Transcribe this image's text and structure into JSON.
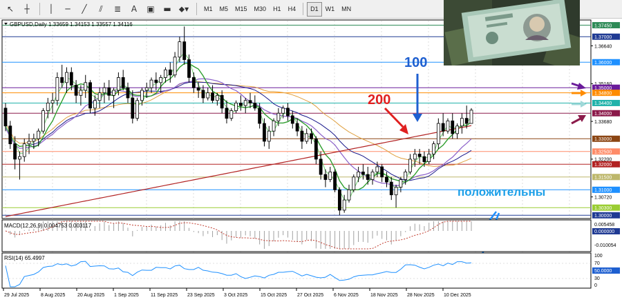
{
  "toolbar": {
    "timeframes": [
      "M1",
      "M5",
      "M15",
      "M30",
      "H1",
      "H4",
      "D1",
      "W1",
      "MN"
    ],
    "active_timeframe": "D1"
  },
  "chart": {
    "symbol_info": "GBPUSD,Daily  1.33659 1.34153 1.33557 1.34116",
    "price_levels": [
      {
        "label": "1.37450",
        "color": "#2e8b57",
        "style": "box"
      },
      {
        "label": "1.37000",
        "color": "#1f3a93",
        "style": "box"
      },
      {
        "label": "1.36640",
        "color": "#000000",
        "style": "tick"
      },
      {
        "label": "1.36000",
        "color": "#1e90ff",
        "style": "box"
      },
      {
        "label": "1.35160",
        "color": "#000000",
        "style": "tick"
      },
      {
        "label": "1.35000",
        "color": "#6a1b9a",
        "style": "box"
      },
      {
        "label": "1.34800",
        "color": "#ff8c00",
        "style": "box"
      },
      {
        "label": "1.34400",
        "color": "#20b2aa",
        "style": "box"
      },
      {
        "label": "1.34000",
        "color": "#8b1a4a",
        "style": "box"
      },
      {
        "label": "1.33680",
        "color": "#000000",
        "style": "tick"
      },
      {
        "label": "1.33000",
        "color": "#8b4513",
        "style": "box"
      },
      {
        "label": "1.32500",
        "color": "#ff8c69",
        "style": "box"
      },
      {
        "label": "1.32200",
        "color": "#000000",
        "style": "tick"
      },
      {
        "label": "1.32000",
        "color": "#b22222",
        "style": "box"
      },
      {
        "label": "1.31500",
        "color": "#bdb76b",
        "style": "box"
      },
      {
        "label": "1.31000",
        "color": "#1e90ff",
        "style": "box"
      },
      {
        "label": "1.30720",
        "color": "#000000",
        "style": "tick"
      },
      {
        "label": "1.30300",
        "color": "#9acd32",
        "style": "box"
      },
      {
        "label": "1.30000",
        "color": "#1f3a93",
        "style": "box"
      }
    ],
    "annotations": {
      "ma100": "100",
      "ma200": "200",
      "positive": "положительны"
    },
    "colors": {
      "ma100": "#1a1a8c",
      "ma200": "#b22222",
      "ma_green": "#2e9e2e",
      "ma_green_light": "#6fcf6f",
      "ma_purple": "#8a5fc9",
      "ma_orange": "#e0a040",
      "annotation_red": "#e02020",
      "annotation_blue": "#1e5fd0",
      "annotation_cyan": "#1ea0e8"
    }
  },
  "macd": {
    "label": "MACD(12,26,9) 0.004753 0.003117",
    "scale": [
      "0.005458",
      "0.000000",
      "-0.010054"
    ]
  },
  "rsi": {
    "label": "RSI(14) 65.4997",
    "scale": [
      "100",
      "70",
      "50.0000",
      "30",
      "0"
    ]
  },
  "time_axis": [
    "29 Jul 2025",
    "8 Aug 2025",
    "20 Aug 2025",
    "1 Sep 2025",
    "11 Sep 2025",
    "23 Sep 2025",
    "3 Oct 2025",
    "15 Oct 2025",
    "27 Oct 2025",
    "6 Nov 2025",
    "18 Nov 2025",
    "28 Nov 2025",
    "10 Dec 2025"
  ],
  "candles": [
    [
      1.342,
      1.344,
      1.333,
      1.335
    ],
    [
      1.335,
      1.337,
      1.326,
      1.328
    ],
    [
      1.328,
      1.331,
      1.318,
      1.322
    ],
    [
      1.322,
      1.325,
      1.314,
      1.323
    ],
    [
      1.323,
      1.33,
      1.321,
      1.328
    ],
    [
      1.328,
      1.332,
      1.324,
      1.329
    ],
    [
      1.329,
      1.332,
      1.326,
      1.33
    ],
    [
      1.33,
      1.334,
      1.327,
      1.333
    ],
    [
      1.333,
      1.342,
      1.332,
      1.341
    ],
    [
      1.341,
      1.346,
      1.338,
      1.344
    ],
    [
      1.344,
      1.348,
      1.34,
      1.345
    ],
    [
      1.345,
      1.356,
      1.343,
      1.354
    ],
    [
      1.354,
      1.359,
      1.35,
      1.352
    ],
    [
      1.352,
      1.358,
      1.348,
      1.356
    ],
    [
      1.356,
      1.358,
      1.349,
      1.351
    ],
    [
      1.351,
      1.353,
      1.344,
      1.347
    ],
    [
      1.347,
      1.351,
      1.343,
      1.349
    ],
    [
      1.349,
      1.355,
      1.346,
      1.352
    ],
    [
      1.352,
      1.353,
      1.34,
      1.342
    ],
    [
      1.342,
      1.347,
      1.339,
      1.345
    ],
    [
      1.345,
      1.35,
      1.342,
      1.348
    ],
    [
      1.348,
      1.352,
      1.344,
      1.35
    ],
    [
      1.35,
      1.353,
      1.345,
      1.347
    ],
    [
      1.347,
      1.35,
      1.342,
      1.349
    ],
    [
      1.349,
      1.356,
      1.347,
      1.354
    ],
    [
      1.354,
      1.357,
      1.349,
      1.35
    ],
    [
      1.35,
      1.352,
      1.344,
      1.346
    ],
    [
      1.346,
      1.349,
      1.336,
      1.338
    ],
    [
      1.338,
      1.346,
      1.337,
      1.345
    ],
    [
      1.345,
      1.35,
      1.343,
      1.349
    ],
    [
      1.349,
      1.352,
      1.346,
      1.35
    ],
    [
      1.35,
      1.354,
      1.348,
      1.353
    ],
    [
      1.353,
      1.356,
      1.349,
      1.352
    ],
    [
      1.352,
      1.355,
      1.348,
      1.354
    ],
    [
      1.354,
      1.358,
      1.352,
      1.357
    ],
    [
      1.357,
      1.36,
      1.352,
      1.355
    ],
    [
      1.355,
      1.364,
      1.354,
      1.362
    ],
    [
      1.362,
      1.37,
      1.36,
      1.368
    ],
    [
      1.368,
      1.374,
      1.359,
      1.361
    ],
    [
      1.361,
      1.363,
      1.352,
      1.354
    ],
    [
      1.354,
      1.356,
      1.348,
      1.35
    ],
    [
      1.35,
      1.352,
      1.346,
      1.349
    ],
    [
      1.349,
      1.351,
      1.344,
      1.346
    ],
    [
      1.346,
      1.35,
      1.345,
      1.348
    ],
    [
      1.348,
      1.351,
      1.344,
      1.345
    ],
    [
      1.345,
      1.348,
      1.343,
      1.347
    ],
    [
      1.347,
      1.349,
      1.34,
      1.342
    ],
    [
      1.342,
      1.345,
      1.336,
      1.338
    ],
    [
      1.338,
      1.342,
      1.337,
      1.341
    ],
    [
      1.341,
      1.345,
      1.34,
      1.344
    ],
    [
      1.344,
      1.347,
      1.341,
      1.343
    ],
    [
      1.343,
      1.346,
      1.34,
      1.345
    ],
    [
      1.345,
      1.348,
      1.342,
      1.344
    ],
    [
      1.344,
      1.347,
      1.341,
      1.342
    ],
    [
      1.342,
      1.344,
      1.334,
      1.336
    ],
    [
      1.336,
      1.338,
      1.327,
      1.329
    ],
    [
      1.329,
      1.335,
      1.326,
      1.333
    ],
    [
      1.333,
      1.338,
      1.331,
      1.337
    ],
    [
      1.337,
      1.342,
      1.335,
      1.34
    ],
    [
      1.34,
      1.343,
      1.338,
      1.342
    ],
    [
      1.342,
      1.344,
      1.337,
      1.339
    ],
    [
      1.339,
      1.341,
      1.334,
      1.336
    ],
    [
      1.336,
      1.338,
      1.331,
      1.333
    ],
    [
      1.333,
      1.335,
      1.326,
      1.329
    ],
    [
      1.329,
      1.334,
      1.328,
      1.332
    ],
    [
      1.332,
      1.334,
      1.328,
      1.33
    ],
    [
      1.33,
      1.331,
      1.32,
      1.322
    ],
    [
      1.322,
      1.325,
      1.314,
      1.316
    ],
    [
      1.316,
      1.318,
      1.311,
      1.314
    ],
    [
      1.314,
      1.319,
      1.313,
      1.317
    ],
    [
      1.317,
      1.318,
      1.309,
      1.31
    ],
    [
      1.31,
      1.311,
      1.3,
      1.302
    ],
    [
      1.302,
      1.308,
      1.301,
      1.306
    ],
    [
      1.306,
      1.312,
      1.305,
      1.31
    ],
    [
      1.31,
      1.316,
      1.309,
      1.315
    ],
    [
      1.315,
      1.319,
      1.313,
      1.317
    ],
    [
      1.317,
      1.32,
      1.314,
      1.316
    ],
    [
      1.316,
      1.319,
      1.312,
      1.314
    ],
    [
      1.314,
      1.318,
      1.312,
      1.317
    ],
    [
      1.317,
      1.321,
      1.315,
      1.319
    ],
    [
      1.319,
      1.32,
      1.313,
      1.315
    ],
    [
      1.315,
      1.317,
      1.311,
      1.313
    ],
    [
      1.313,
      1.315,
      1.306,
      1.308
    ],
    [
      1.308,
      1.312,
      1.303,
      1.311
    ],
    [
      1.311,
      1.315,
      1.309,
      1.314
    ],
    [
      1.314,
      1.318,
      1.312,
      1.317
    ],
    [
      1.317,
      1.324,
      1.316,
      1.322
    ],
    [
      1.322,
      1.326,
      1.319,
      1.324
    ],
    [
      1.324,
      1.326,
      1.32,
      1.323
    ],
    [
      1.323,
      1.325,
      1.319,
      1.321
    ],
    [
      1.321,
      1.326,
      1.32,
      1.324
    ],
    [
      1.324,
      1.329,
      1.322,
      1.328
    ],
    [
      1.328,
      1.338,
      1.326,
      1.336
    ],
    [
      1.336,
      1.34,
      1.331,
      1.333
    ],
    [
      1.333,
      1.338,
      1.332,
      1.337
    ],
    [
      1.337,
      1.34,
      1.33,
      1.332
    ],
    [
      1.332,
      1.336,
      1.33,
      1.335
    ],
    [
      1.335,
      1.34,
      1.332,
      1.338
    ],
    [
      1.338,
      1.343,
      1.334,
      1.336
    ],
    [
      1.336,
      1.342,
      1.336,
      1.3412
    ]
  ]
}
